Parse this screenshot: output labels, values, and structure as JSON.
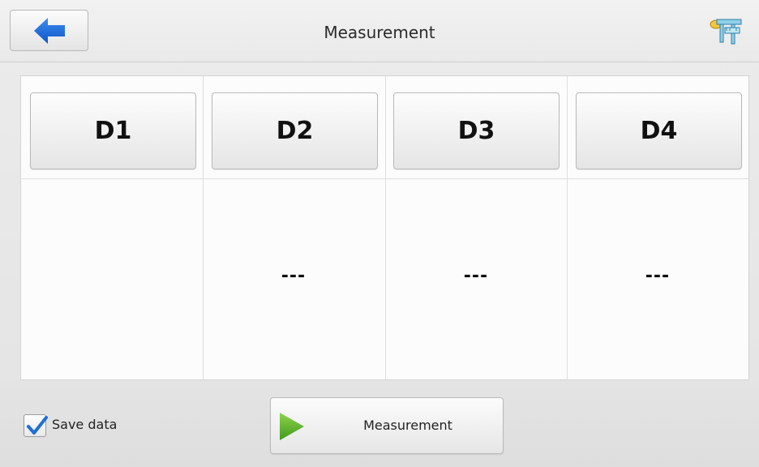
{
  "header": {
    "title": "Measurement",
    "back_icon": "arrow-left-icon",
    "tool_icon": "caliper-icon"
  },
  "columns": [
    {
      "label": "D1",
      "value": ""
    },
    {
      "label": "D2",
      "value": "---"
    },
    {
      "label": "D3",
      "value": "---"
    },
    {
      "label": "D4",
      "value": "---"
    }
  ],
  "footer": {
    "save_data_label": "Save data",
    "save_data_checked": true,
    "measure_button_label": "Measurement",
    "measure_icon": "play-icon"
  },
  "colors": {
    "arrow_blue": "#1565d8",
    "play_green": "#57b52a",
    "check_blue": "#1f6fd6"
  }
}
